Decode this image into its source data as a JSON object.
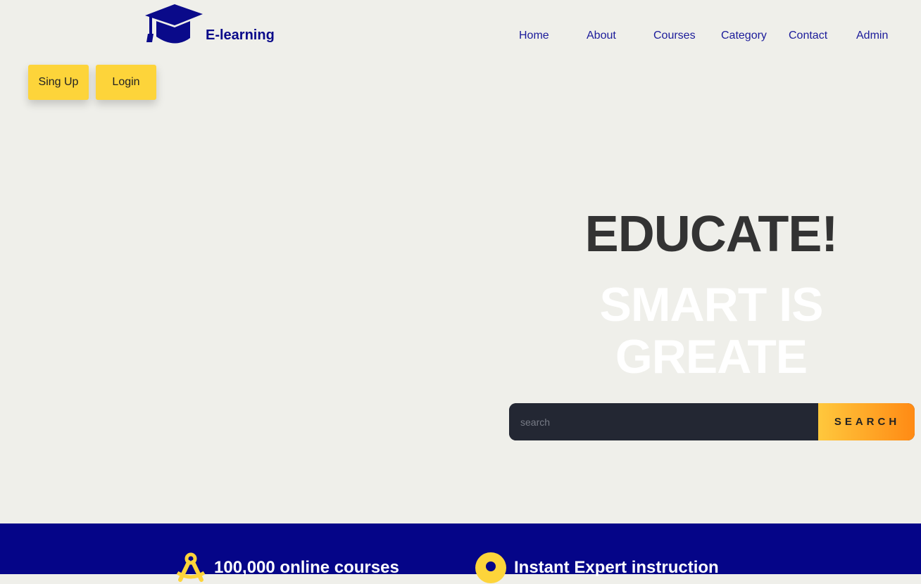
{
  "brand": {
    "name": "E-learning",
    "icon": "graduation-cap-icon",
    "color": "#0a0a8a"
  },
  "nav": [
    {
      "label": "Home"
    },
    {
      "label": "About"
    },
    {
      "label": "Courses"
    },
    {
      "label": "Category"
    },
    {
      "label": "Contact"
    },
    {
      "label": "Admin"
    }
  ],
  "auth": {
    "signup_label": "Sing Up",
    "login_label": "Login"
  },
  "hero": {
    "title": "EDUCATE!",
    "subtitle_line1": "SMART IS",
    "subtitle_line2": "GREATE"
  },
  "search": {
    "placeholder": "search",
    "button_label": "SEARCH"
  },
  "features": [
    {
      "text": "100,000 online courses",
      "icon": "compass-icon"
    },
    {
      "text": "Instant Expert instruction",
      "icon": "location-pin-icon"
    }
  ],
  "colors": {
    "accent": "#fdd43a",
    "band": "#050588",
    "background": "#efefea"
  }
}
